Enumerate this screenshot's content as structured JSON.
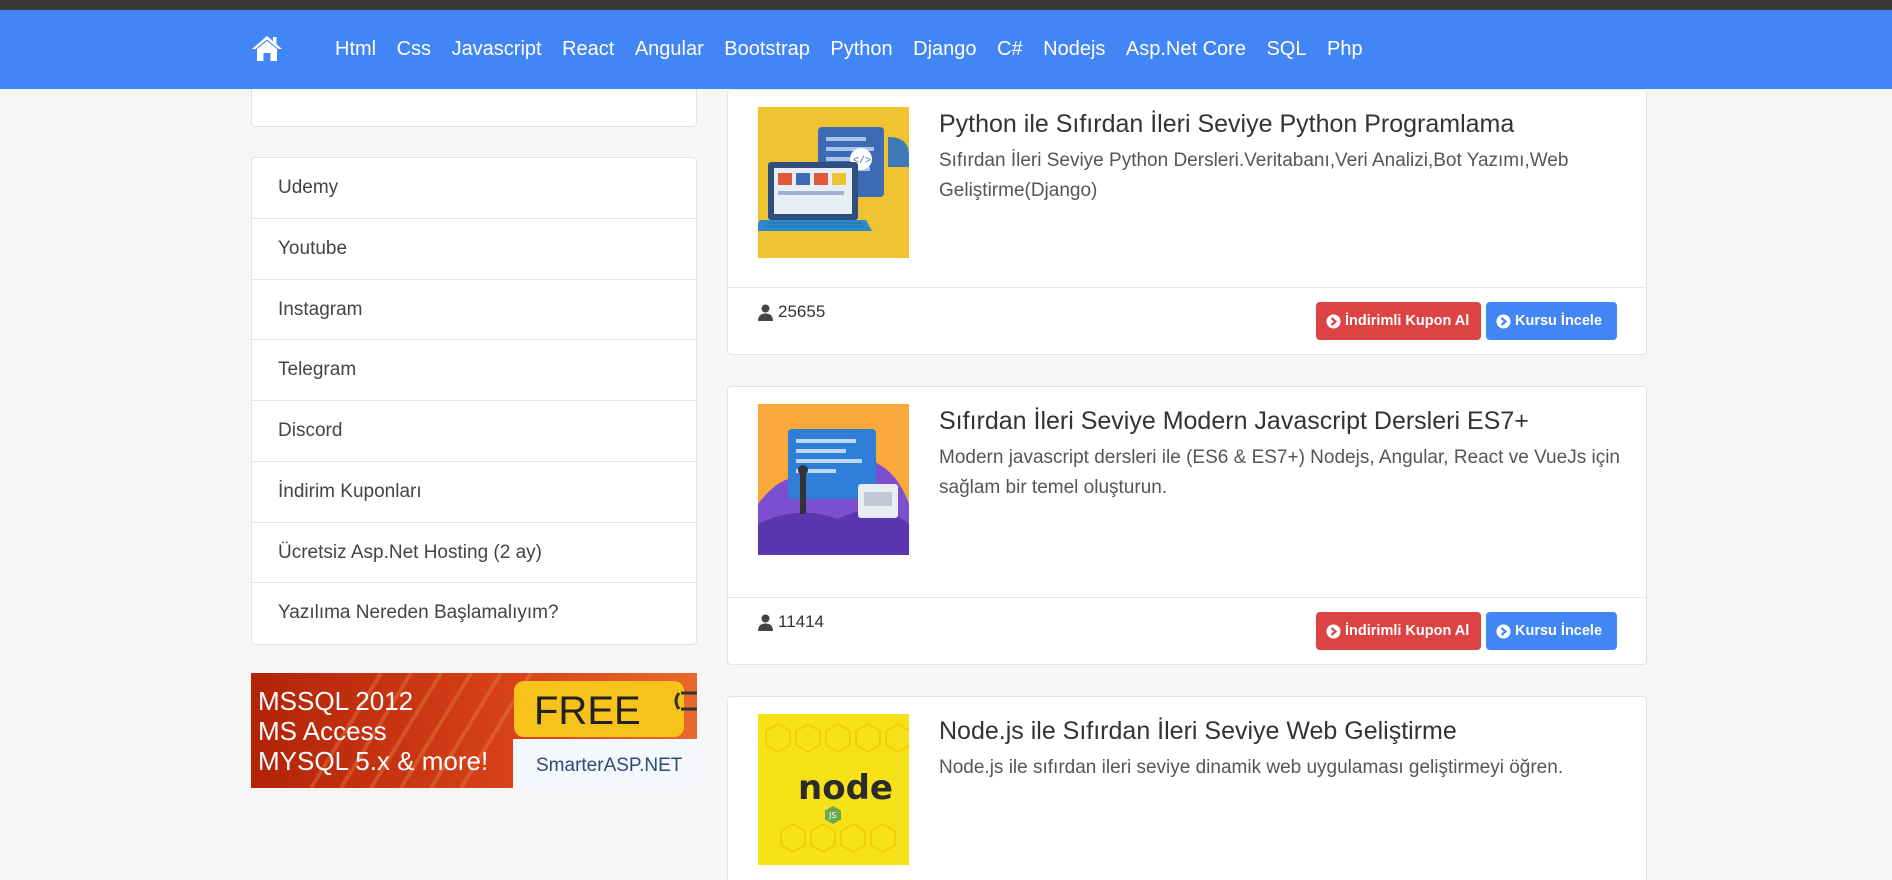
{
  "nav": {
    "links": [
      "Html",
      "Css",
      "Javascript",
      "React",
      "Angular",
      "Bootstrap",
      "Python",
      "Django",
      "C#",
      "Nodejs",
      "Asp.Net Core",
      "SQL",
      "Php"
    ]
  },
  "sidebar": {
    "items": [
      "Udemy",
      "Youtube",
      "Instagram",
      "Telegram",
      "Discord",
      "İndirim Kuponları",
      "Ücretsiz Asp.Net Hosting (2 ay)",
      "Yazılıma Nereden Başlamalıyım?"
    ],
    "banner": {
      "line1": "MSSQL 2012",
      "line2": "MS Access",
      "line3": "MYSQL 5.x & more!",
      "free": "FREE",
      "brand": "SmarterASP.NET"
    }
  },
  "courses": [
    {
      "title": "Python ile Sıfırdan İleri Seviye Python Programlama",
      "description": "Sıfırdan İleri Seviye Python Dersleri.Veritabanı,Veri Analizi,Bot Yazımı,Web Geliştirme(Django)",
      "students": "25655",
      "coupon_label": "İndirimli Kupon Al",
      "details_label": "Kursu İncele"
    },
    {
      "title": "Sıfırdan İleri Seviye Modern Javascript Dersleri ES7+",
      "description": "Modern javascript dersleri ile (ES6 & ES7+) Nodejs, Angular, React ve VueJs için sağlam bir temel oluşturun.",
      "students": "11414",
      "coupon_label": "İndirimli Kupon Al",
      "details_label": "Kursu İncele"
    },
    {
      "title": "Node.js ile Sıfırdan İleri Seviye Web Geliştirme",
      "description": "Node.js ile sıfırdan ileri seviye dinamik web uygulaması geliştirmeyi öğren.",
      "thumb_text": "node"
    }
  ],
  "colors": {
    "navbar": "#4285f4",
    "coupon_button": "#dc4343",
    "course_button": "#4285f4"
  },
  "icons": [
    "home-icon",
    "user-icon",
    "arrow-circle-right-icon"
  ]
}
